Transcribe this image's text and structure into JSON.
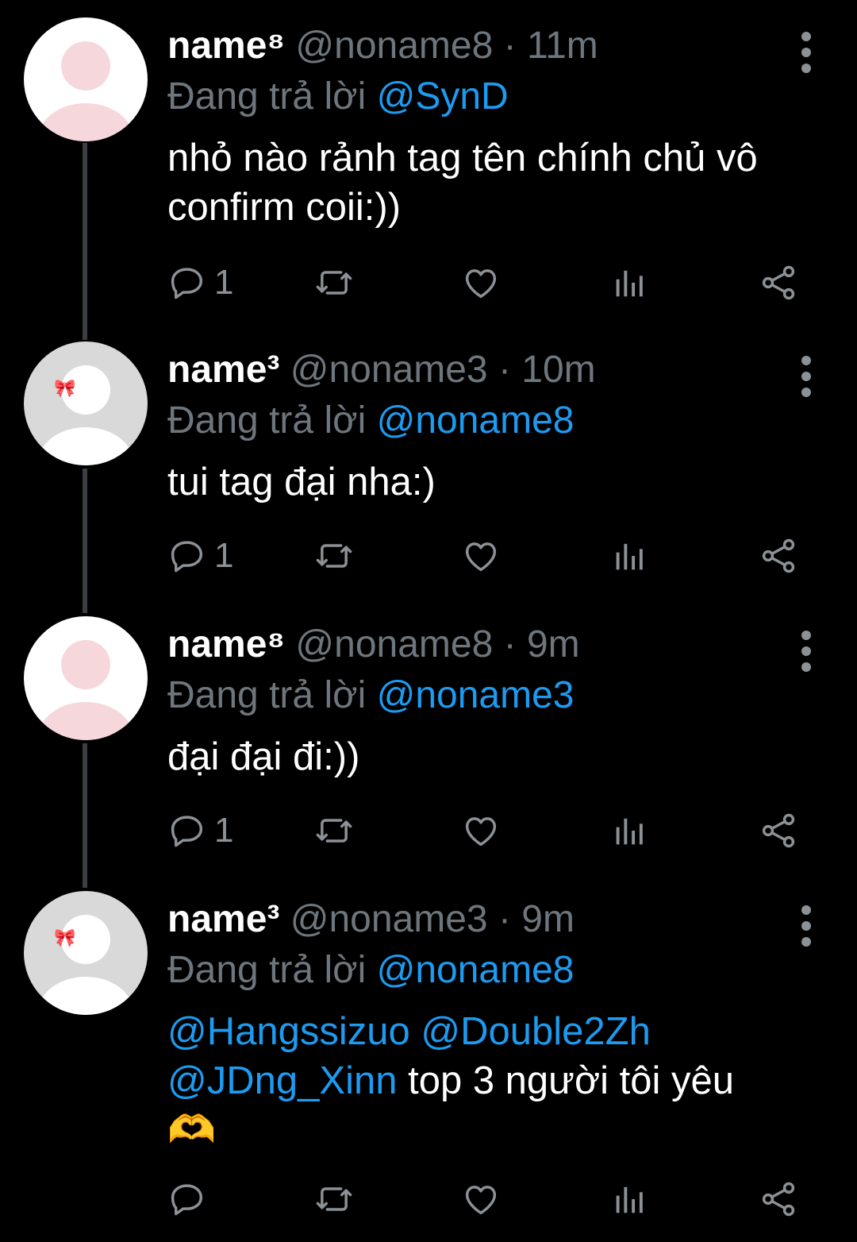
{
  "tweets": [
    {
      "display_name": "name⁸",
      "handle": "@noname8",
      "time": "· 11m",
      "reply_prefix": "Đang trả lời",
      "reply_to": "@SynD",
      "text_line1": "nhỏ nào rảnh tag tên chính chủ vô",
      "text_line2": "confirm coii:))",
      "reply_count": "1",
      "avatar": "pink-default-avatar"
    },
    {
      "display_name": "name³",
      "handle": "@noname3",
      "time": "· 10m",
      "reply_prefix": "Đang trả lời",
      "reply_to": "@noname8",
      "text_line1": "tui tag đại nha:)",
      "reply_count": "1",
      "avatar": "grey-avatar-with-bow"
    },
    {
      "display_name": "name⁸",
      "handle": "@noname8",
      "time": "· 9m",
      "reply_prefix": "Đang trả lời",
      "reply_to": "@noname3",
      "text_line1": "đại đại đi:))",
      "reply_count": "1",
      "avatar": "pink-default-avatar"
    },
    {
      "display_name": "name³",
      "handle": "@noname3",
      "time": "· 9m",
      "reply_prefix": "Đang trả lời",
      "reply_to": "@noname8",
      "mention1": "@Hangssizuo",
      "mention2": "@Double2Zh",
      "mention3": "@JDng_Xinn",
      "text_rest": " top 3 người tôi yêu",
      "emoji": "🫶",
      "reply_count": "",
      "avatar": "grey-avatar-with-bow"
    }
  ],
  "icons": {
    "more": "more-vertical-icon",
    "reply": "reply-bubble-icon",
    "retweet": "retweet-icon",
    "like": "heart-icon",
    "views": "bar-chart-icon",
    "share": "share-icon"
  },
  "colors": {
    "background": "#000000",
    "mention": "#1d9bf0",
    "muted": "#6e767d",
    "thread_line": "#3a3f44"
  }
}
